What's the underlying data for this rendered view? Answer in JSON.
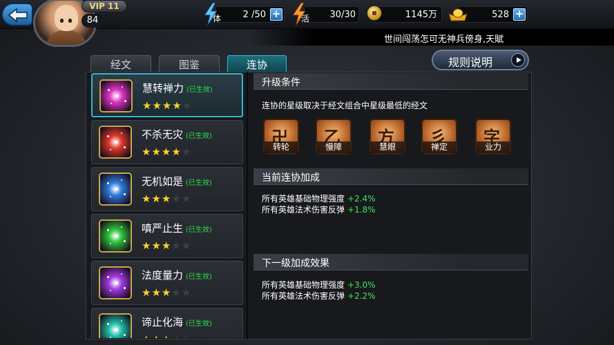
{
  "top_bar": {
    "vip": "VIP 11",
    "level": "84",
    "stamina": {
      "icon": "lightning-icon",
      "label": "体",
      "value": "2 /50"
    },
    "energy": {
      "icon": "lightning-icon",
      "label": "活",
      "value": "30/30"
    },
    "coins": {
      "icon": "copper-coin-icon",
      "value": "1145万"
    },
    "ingots": {
      "icon": "gold-ingot-icon",
      "value": "528"
    },
    "add_symbol": "+"
  },
  "marquee": "世间闯荡怎可无神兵傍身,天賦",
  "tabs": [
    {
      "label": "经文",
      "active": false
    },
    {
      "label": "图鉴",
      "active": false
    },
    {
      "label": "连协",
      "active": true
    }
  ],
  "rules_button": "规则说明",
  "combos": [
    {
      "name": "慧转禅力",
      "state": "(已生效)",
      "stars": 4,
      "max_stars": 5,
      "gem_color": "#e034c4",
      "selected": true
    },
    {
      "name": "不杀无灾",
      "state": "(已生效)",
      "stars": 4,
      "max_stars": 5,
      "gem_color": "#e0392a",
      "selected": false
    },
    {
      "name": "无机如是",
      "state": "(已生效)",
      "stars": 3,
      "max_stars": 5,
      "gem_color": "#2f7de0",
      "selected": false
    },
    {
      "name": "嗔严止生",
      "state": "(已生效)",
      "stars": 3,
      "max_stars": 5,
      "gem_color": "#2ec43a",
      "selected": false
    },
    {
      "name": "法度量力",
      "state": "(已生效)",
      "stars": 3,
      "max_stars": 5,
      "gem_color": "#a33be0",
      "selected": false
    },
    {
      "name": "谛止化海",
      "state": "(已生效)",
      "stars": 3,
      "max_stars": 5,
      "gem_color": "#1fc0a8",
      "selected": false
    }
  ],
  "upgrade": {
    "title": "升级条件",
    "desc": "连协的星级取决于经文组合中星级最低的经文",
    "scrolls": [
      {
        "glyph": "卍",
        "label": "转轮"
      },
      {
        "glyph": "乙",
        "label": "慢障"
      },
      {
        "glyph": "方",
        "label": "慧眼"
      },
      {
        "glyph": "彡",
        "label": "禅定"
      },
      {
        "glyph": "字",
        "label": "业力"
      }
    ]
  },
  "current_bonus": {
    "title": "当前连协加成",
    "lines": [
      {
        "text": "所有英雄基础物理强度",
        "value": "+2.4%"
      },
      {
        "text": "所有英雄法术伤害反弹",
        "value": "+1.8%"
      }
    ]
  },
  "next_bonus": {
    "title": "下一级加成效果",
    "lines": [
      {
        "text": "所有英雄基础物理强度",
        "value": "+3.0%"
      },
      {
        "text": "所有英雄法术伤害反弹",
        "value": "+2.2%"
      }
    ]
  }
}
